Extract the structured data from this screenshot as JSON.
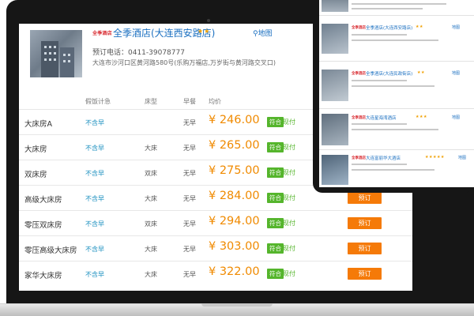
{
  "hotel": {
    "logo_text": "全季酒店",
    "name": "全季酒店(大连西安路店)",
    "stars": "★★",
    "map_link": "地图",
    "phone": "预订电话：0411-39078777",
    "address": "大连市沙河口区黄河路580号(乐购万福店,万岁街与黄河路交叉口)"
  },
  "table_headers": {
    "breakfast_policy": "假饭计急",
    "bed": "床型",
    "meal": "早餐",
    "price": "均价"
  },
  "rooms": [
    {
      "name": "大床房A",
      "policy": "不含早",
      "bed": "",
      "meal": "无早",
      "price": "¥ 246.00",
      "badge": "符合",
      "pay": "现付",
      "action": ""
    },
    {
      "name": "大床房",
      "policy": "不含早",
      "bed": "大床",
      "meal": "无早",
      "price": "¥ 265.00",
      "badge": "符合",
      "pay": "现付",
      "action": ""
    },
    {
      "name": "双床房",
      "policy": "不含早",
      "bed": "双床",
      "meal": "无早",
      "price": "¥ 275.00",
      "badge": "符合",
      "pay": "现付",
      "action": ""
    },
    {
      "name": "高级大床房",
      "policy": "不含早",
      "bed": "大床",
      "meal": "无早",
      "price": "¥ 284.00",
      "badge": "符合",
      "pay": "现付",
      "action": "预订"
    },
    {
      "name": "零压双床房",
      "policy": "不含早",
      "bed": "双床",
      "meal": "无早",
      "price": "¥ 294.00",
      "badge": "符合",
      "pay": "现付",
      "action": "预订"
    },
    {
      "name": "零压高级大床房",
      "policy": "不含早",
      "bed": "大床",
      "meal": "无早",
      "price": "¥ 303.00",
      "badge": "符合",
      "pay": "现付",
      "action": "预订"
    },
    {
      "name": "家华大床房",
      "policy": "不含早",
      "bed": "大床",
      "meal": "无早",
      "price": "¥ 322.00",
      "badge": "符合",
      "pay": "现付",
      "action": "预订"
    }
  ],
  "phone_list": [
    {
      "logo": "全季酒店",
      "name": "全季酒店(大连西安路店)",
      "stars": "★★",
      "map": "地图"
    },
    {
      "logo": "全季酒店",
      "name": "全季酒店(大连民政街店)",
      "stars": "★★",
      "map": "地图"
    },
    {
      "logo": "全季酒店",
      "name": "全季酒店(大连民政街店)",
      "stars": "★★",
      "map": "地图"
    },
    {
      "logo": "全季酒店",
      "name": "大连星海湾酒店",
      "stars": "★★★",
      "map": "地图"
    },
    {
      "logo": "全季酒店",
      "name": "大连富丽华大酒店",
      "stars": "★★★★★",
      "map": "地图"
    }
  ],
  "colors": {
    "link_blue": "#1a6fc0",
    "price_orange": "#f08a00",
    "book_orange": "#f57a08",
    "badge_green": "#55b52c",
    "star_gold": "#f0a000",
    "brand_red": "#d8282e"
  }
}
